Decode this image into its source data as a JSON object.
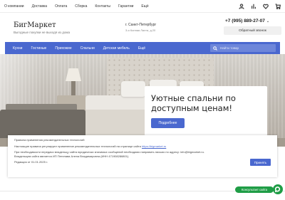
{
  "topbar": {
    "nav": [
      "О компании",
      "Доставка",
      "Оплата",
      "Сборка",
      "Контакты",
      "Гарантии",
      "Ещё"
    ],
    "icons": [
      "user-icon",
      "compare-icon",
      "heart-icon",
      "cart-icon"
    ]
  },
  "header": {
    "logo": "БигМаркет",
    "tagline": "Выгодные покупки не выходя из дома",
    "city": "г. Санкт-Петербург",
    "address": "3-я Конная Лахта, д.20",
    "phone": "+7 (995) 889-27-07",
    "callback_label": "Обратный звонок"
  },
  "navbar": {
    "items": [
      "Кухни",
      "Гостиные",
      "Прихожие",
      "Спальни",
      "Детская мебель",
      "Ещё"
    ],
    "search_placeholder": "Найти товар"
  },
  "hero": {
    "title": "Уютные спальни по доступным ценам!",
    "button_label": "Подробнее"
  },
  "notice": {
    "heading": "Правила применения рекомендательных технологий",
    "line1": "Настоящие правила регулируют применение рекомендательных технологий на странице сайта",
    "link": "https://bigmarket.ru",
    "line2": "При необходимости передачи владельцу сайта юридически значимых сообщений необходимо направить письмо по адресу: info@bigmarket.ru.",
    "line3": "Владельцем сайта является ИП Петелава Алена Владимировна (ИНН 471908286801).",
    "edition": "Редакция от 01.01.2025 г.",
    "accept_label": "Принять"
  },
  "widget": {
    "consult_label": "Консультант сайта"
  },
  "colors": {
    "accent": "#4a68cf",
    "chat": "#1f9d46"
  }
}
